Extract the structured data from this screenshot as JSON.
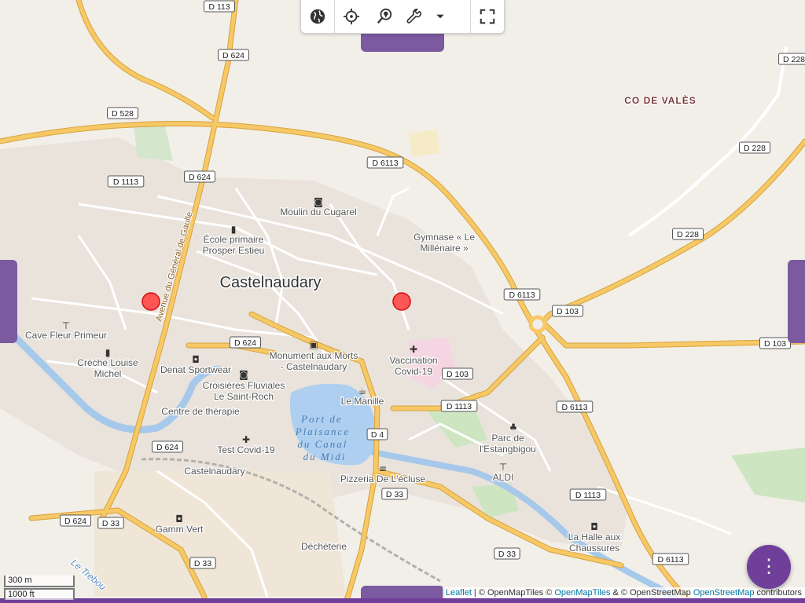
{
  "map": {
    "colors": {
      "land": "#f2efe9",
      "urban": "#e9e3dc",
      "water": "#aecff0",
      "river": "#a6c8ea",
      "major_road": "#f7c866",
      "major_road_casing": "#d6a23c",
      "minor_road": "#ffffff",
      "park": "#cde6c1",
      "hospital": "#f5d5e2",
      "marker_fill": "#ff3d3d",
      "ui_accent": "#7b5aa0"
    },
    "place_label": "Castelnaudary",
    "area_label": "CO DE VALÈS",
    "street_label": "Avenue du Général de Gaulle",
    "water_label_lines": [
      "Port de",
      "Plaisance",
      "du Canal",
      "du Midi"
    ],
    "road_shields": [
      {
        "id": "r-d113",
        "text": "D 113"
      },
      {
        "id": "r-d624-a",
        "text": "D 624"
      },
      {
        "id": "r-d528",
        "text": "D 528"
      },
      {
        "id": "r-d1113-a",
        "text": "D 1113"
      },
      {
        "id": "r-d624-b",
        "text": "D 624"
      },
      {
        "id": "r-d6113-a",
        "text": "D 6113"
      },
      {
        "id": "r-d228-a",
        "text": "D 228"
      },
      {
        "id": "r-d228-b",
        "text": "D 228"
      },
      {
        "id": "r-d228-c",
        "text": "D 228"
      },
      {
        "id": "r-d6113-b",
        "text": "D 6113"
      },
      {
        "id": "r-d103-a",
        "text": "D 103"
      },
      {
        "id": "r-d103-b",
        "text": "D 103"
      },
      {
        "id": "r-d624-c",
        "text": "D 624"
      },
      {
        "id": "r-d103-c",
        "text": "D 103"
      },
      {
        "id": "r-d1113-b",
        "text": "D 1113"
      },
      {
        "id": "r-d6113-c",
        "text": "D 6113"
      },
      {
        "id": "r-d4",
        "text": "D 4"
      },
      {
        "id": "r-d624-d",
        "text": "D 624"
      },
      {
        "id": "r-d33-a",
        "text": "D 33"
      },
      {
        "id": "r-d1113-c",
        "text": "D 1113"
      },
      {
        "id": "r-d624-e",
        "text": "D 624"
      },
      {
        "id": "r-d33-b",
        "text": "D 33"
      },
      {
        "id": "r-d33-c",
        "text": "D 33"
      },
      {
        "id": "r-d33-d",
        "text": "D 33"
      },
      {
        "id": "r-d6113-d",
        "text": "D 6113"
      }
    ],
    "pois": [
      {
        "id": "moulin",
        "lines": [
          "Moulin du Cugarel"
        ],
        "icon": "camera-icon"
      },
      {
        "id": "ecole",
        "lines": [
          "École primaire",
          "Prosper Estieu"
        ],
        "icon": "school-icon"
      },
      {
        "id": "gymnase",
        "lines": [
          "Gymnase « Le",
          "Millénaire »"
        ],
        "icon": ""
      },
      {
        "id": "cavefleur",
        "lines": [
          "Cave Fleur Primeur"
        ],
        "icon": "shop-icon"
      },
      {
        "id": "creche",
        "lines": [
          "Créche Louise",
          "Michel"
        ],
        "icon": "school-icon"
      },
      {
        "id": "denat",
        "lines": [
          "Denat Sportwear"
        ],
        "icon": "shopping-bag-icon"
      },
      {
        "id": "monument",
        "lines": [
          "Monument aux Morts",
          "- Castelnaudary"
        ],
        "icon": "bus-icon"
      },
      {
        "id": "vaccination",
        "lines": [
          "Vaccination",
          "Covid-19"
        ],
        "icon": "medical-cross-icon"
      },
      {
        "id": "croisieres",
        "lines": [
          "Croisières Fluviales",
          "Le Saint-Roch"
        ],
        "icon": "camera-icon"
      },
      {
        "id": "manille",
        "lines": [
          "Le Manille"
        ],
        "icon": "cafe-icon"
      },
      {
        "id": "therapie",
        "lines": [
          "Centre de thérapie"
        ],
        "icon": ""
      },
      {
        "id": "testcovid",
        "lines": [
          "Test Covid-19"
        ],
        "icon": "medical-cross-icon"
      },
      {
        "id": "castel2",
        "lines": [
          "Castelnaudary"
        ],
        "icon": ""
      },
      {
        "id": "pizzeria",
        "lines": [
          "Pizzeria De L'écluse"
        ],
        "icon": "restaurant-icon"
      },
      {
        "id": "parc",
        "lines": [
          "Parc de",
          "l'Estangbigou"
        ],
        "icon": "tree-icon"
      },
      {
        "id": "aldi",
        "lines": [
          "ALDI"
        ],
        "icon": "shop-icon"
      },
      {
        "id": "gamm",
        "lines": [
          "Gamm Vert"
        ],
        "icon": "shopping-bag-icon"
      },
      {
        "id": "halle",
        "lines": [
          "La Halle aux",
          "Chaussures"
        ],
        "icon": "shopping-bag-icon"
      },
      {
        "id": "decheterie",
        "lines": [
          "Déchèterie"
        ],
        "icon": ""
      },
      {
        "id": "trebou",
        "lines": [
          "Le Trebou"
        ],
        "icon": ""
      }
    ],
    "markers": [
      {
        "id": "marker-1",
        "name": "location-marker"
      },
      {
        "id": "marker-2",
        "name": "location-marker"
      }
    ]
  },
  "toolbar": {
    "buttons": [
      {
        "id": "layers",
        "icon": "globe-icon"
      },
      {
        "id": "locate",
        "icon": "crosshair-icon"
      },
      {
        "id": "search-place",
        "icon": "search-location-icon"
      },
      {
        "id": "tools",
        "icon": "wrench-icon"
      },
      {
        "id": "tools-menu",
        "icon": "caret-down-icon"
      },
      {
        "id": "fullscreen",
        "icon": "fullscreen-icon"
      }
    ]
  },
  "scale": {
    "metric": "300 m",
    "imperial": "1000 ft"
  },
  "attribution": {
    "leaflet": "Leaflet",
    "sep1": " | © OpenMapTiles © ",
    "omt": "OpenMapTiles",
    "sep2": " & © OpenStreetMap ",
    "osm": "OpenStreetMap",
    "tail": " contributors"
  },
  "fab": {
    "icon": "more-vertical-icon",
    "glyph": "⋮"
  }
}
